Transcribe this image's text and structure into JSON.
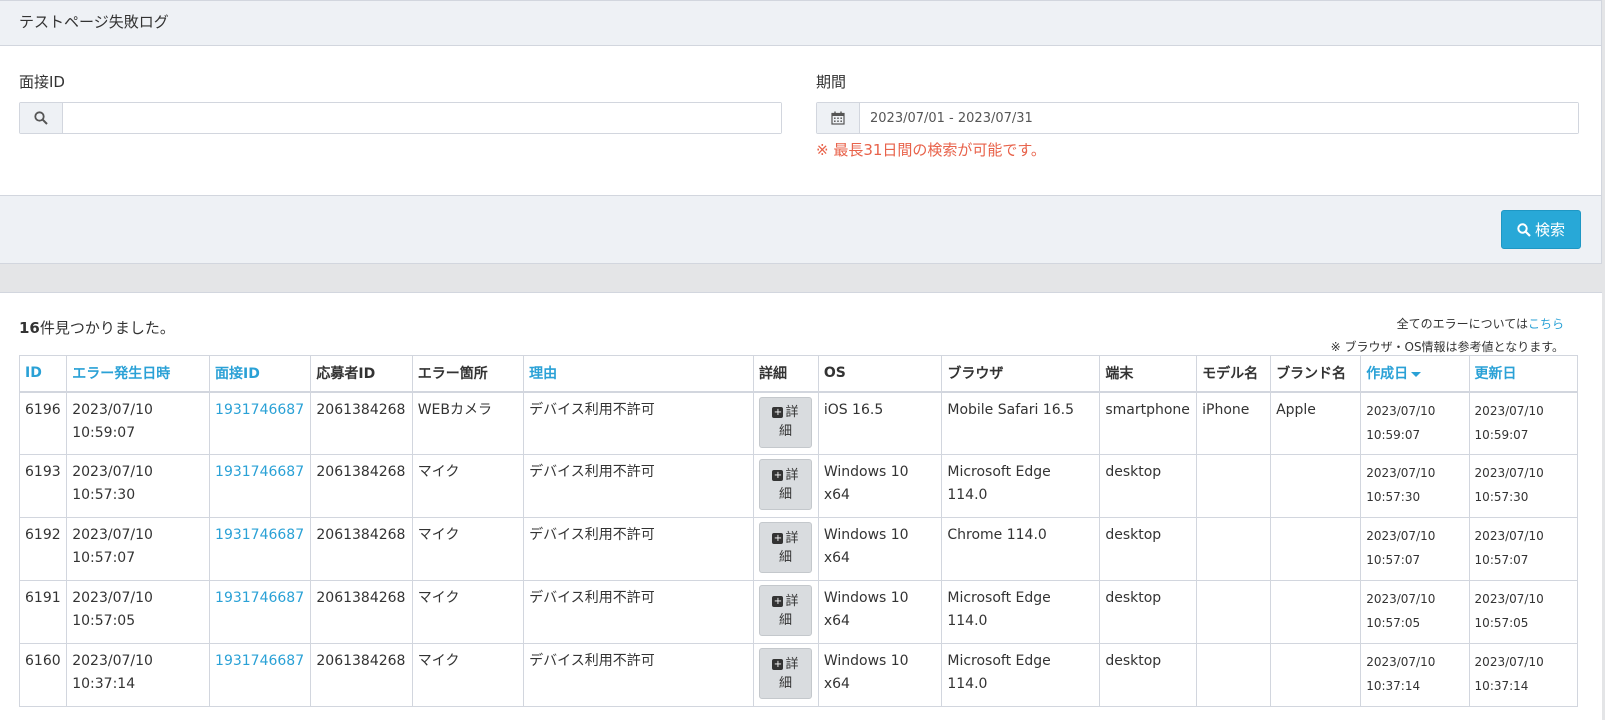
{
  "panel": {
    "title": "テストページ失敗ログ",
    "interview_label": "面接ID",
    "interview_value": "",
    "period_label": "期間",
    "period_value": "2023/07/01 - 2023/07/31",
    "period_help": "※ 最長31日間の検索が可能です。",
    "search_button": "検索"
  },
  "results": {
    "count_number": "16",
    "count_text": "件見つかりました。",
    "note_prefix": "全てのエラーについては",
    "note_link": "こちら",
    "note_line2": "※ ブラウザ・OS情報は参考値となります。"
  },
  "table": {
    "headers": {
      "id": "ID",
      "error_time": "エラー発生日時",
      "interview_id": "面接ID",
      "applicant_id": "応募者ID",
      "error_place": "エラー箇所",
      "reason": "理由",
      "detail": "詳細",
      "os": "OS",
      "browser": "ブラウザ",
      "device": "端末",
      "model": "モデル名",
      "brand": "ブランド名",
      "created": "作成日",
      "updated": "更新日"
    },
    "detail_button": {
      "line1": "詳",
      "line2": "細"
    },
    "rows": [
      {
        "id": "6196",
        "date": "2023/07/10",
        "time": "10:59:07",
        "interview_id": "1931746687",
        "applicant_id": "2061384268",
        "place": "WEBカメラ",
        "reason": "デバイス利用不許可",
        "os": "iOS 16.5",
        "browser": "Mobile Safari 16.5",
        "device": "smartphone",
        "model": "iPhone",
        "brand": "Apple",
        "created_date": "2023/07/10",
        "created_time": "10:59:07",
        "updated_date": "2023/07/10",
        "updated_time": "10:59:07"
      },
      {
        "id": "6193",
        "date": "2023/07/10",
        "time": "10:57:30",
        "interview_id": "1931746687",
        "applicant_id": "2061384268",
        "place": "マイク",
        "reason": "デバイス利用不許可",
        "os": "Windows 10 x64",
        "browser": "Microsoft Edge 114.0",
        "device": "desktop",
        "model": "",
        "brand": "",
        "created_date": "2023/07/10",
        "created_time": "10:57:30",
        "updated_date": "2023/07/10",
        "updated_time": "10:57:30"
      },
      {
        "id": "6192",
        "date": "2023/07/10",
        "time": "10:57:07",
        "interview_id": "1931746687",
        "applicant_id": "2061384268",
        "place": "マイク",
        "reason": "デバイス利用不許可",
        "os": "Windows 10 x64",
        "browser": "Chrome 114.0",
        "device": "desktop",
        "model": "",
        "brand": "",
        "created_date": "2023/07/10",
        "created_time": "10:57:07",
        "updated_date": "2023/07/10",
        "updated_time": "10:57:07"
      },
      {
        "id": "6191",
        "date": "2023/07/10",
        "time": "10:57:05",
        "interview_id": "1931746687",
        "applicant_id": "2061384268",
        "place": "マイク",
        "reason": "デバイス利用不許可",
        "os": "Windows 10 x64",
        "browser": "Microsoft Edge 114.0",
        "device": "desktop",
        "model": "",
        "brand": "",
        "created_date": "2023/07/10",
        "created_time": "10:57:05",
        "updated_date": "2023/07/10",
        "updated_time": "10:57:05"
      },
      {
        "id": "6160",
        "date": "2023/07/10",
        "time": "10:37:14",
        "interview_id": "1931746687",
        "applicant_id": "2061384268",
        "place": "マイク",
        "reason": "デバイス利用不許可",
        "os": "Windows 10 x64",
        "browser": "Microsoft Edge 114.0",
        "device": "desktop",
        "model": "",
        "brand": "",
        "created_date": "2023/07/10",
        "created_time": "10:37:14",
        "updated_date": "2023/07/10",
        "updated_time": "10:37:14"
      }
    ]
  },
  "colors": {
    "link": "#2aa1d6",
    "primary_button": "#28a8d7",
    "help_text": "#e8624a"
  }
}
